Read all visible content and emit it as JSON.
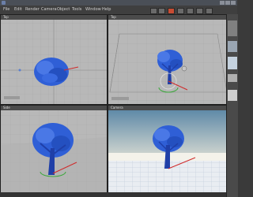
{
  "app": {
    "title": ""
  },
  "menu": [
    {
      "label": "File"
    },
    {
      "label": "Edit"
    },
    {
      "label": "Render"
    },
    {
      "label": "Camera"
    },
    {
      "label": "Object"
    },
    {
      "label": "Tools"
    },
    {
      "label": "Window"
    },
    {
      "label": "Help"
    }
  ],
  "viewports": [
    {
      "name": "top-left-viewport",
      "label": "Top"
    },
    {
      "name": "top-right-viewport",
      "label": "Top"
    },
    {
      "name": "bottom-left-viewport",
      "label": "Side"
    },
    {
      "name": "bottom-right-viewport",
      "label": "Camera"
    }
  ],
  "colors": {
    "viewport_bg": "#b8b8b8",
    "tree_blue": "#2f5fd6",
    "axis_red": "#d02a2a",
    "sky_top": "#5f8aa8",
    "sky_bottom": "#e9e6d8",
    "gizmo_green": "#3ca83c"
  },
  "icons": [
    "app-icon",
    "minimize-icon",
    "maximize-icon",
    "close-icon"
  ]
}
